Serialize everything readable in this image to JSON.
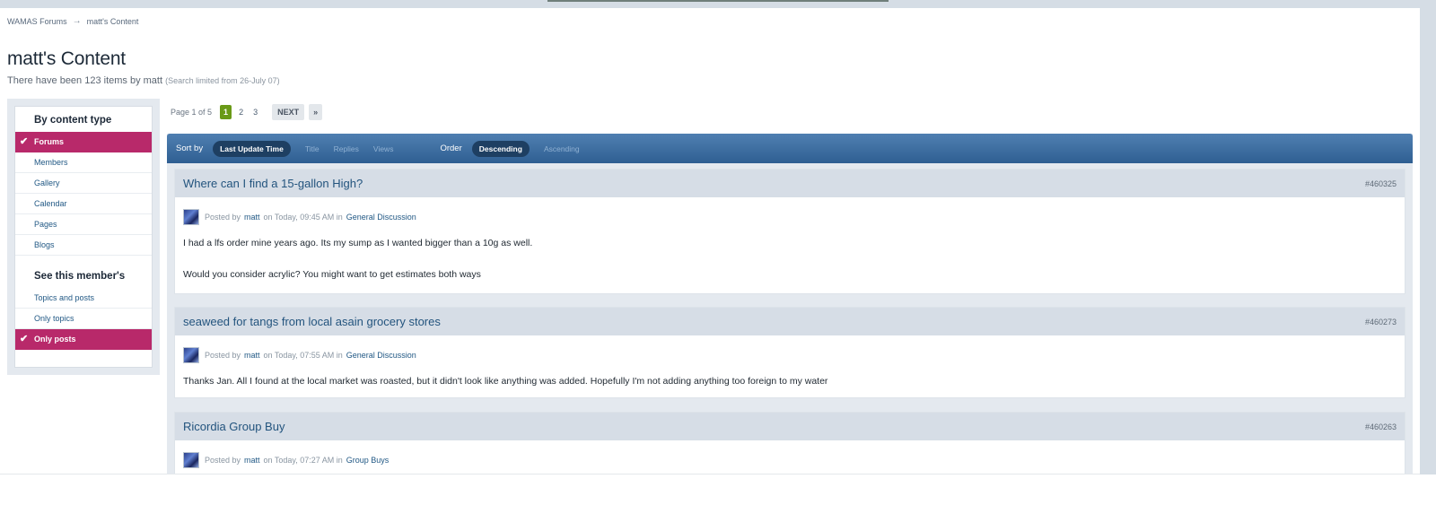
{
  "breadcrumb": {
    "root": "WAMAS Forums",
    "separator": "→",
    "current": "matt's Content"
  },
  "header": {
    "title": "matt's Content",
    "subtitle": "There have been 123 items by matt",
    "limit_note": "(Search limited from 26-July 07)"
  },
  "sidebar": {
    "heading1": "By content type",
    "content_types": [
      {
        "label": "Forums",
        "active": true
      },
      {
        "label": "Members",
        "active": false
      },
      {
        "label": "Gallery",
        "active": false
      },
      {
        "label": "Calendar",
        "active": false
      },
      {
        "label": "Pages",
        "active": false
      },
      {
        "label": "Blogs",
        "active": false
      }
    ],
    "heading2": "See this member's",
    "member_views": [
      {
        "label": "Topics and posts",
        "active": false
      },
      {
        "label": "Only topics",
        "active": false
      },
      {
        "label": "Only posts",
        "active": true
      }
    ],
    "check_glyph": "✔"
  },
  "pagination": {
    "label": "Page 1 of 5",
    "pages": [
      "1",
      "2",
      "3"
    ],
    "current": "1",
    "next": "NEXT",
    "last": "»"
  },
  "sortbar": {
    "sort_label": "Sort by",
    "sort_active": "Last Update Time",
    "sort_options": [
      "Title",
      "Replies",
      "Views"
    ],
    "order_label": "Order",
    "order_active": "Descending",
    "order_options": [
      "Ascending"
    ]
  },
  "posts": [
    {
      "title": "Where can I find a 15-gallon High?",
      "id": "#460325",
      "posted_by": "Posted by",
      "user": "matt",
      "on": "on Today, 09:45 AM in",
      "forum": "General Discussion",
      "body": [
        "I had a lfs order mine years ago. Its my sump as I wanted bigger than a 10g as well.",
        "Would you consider acrylic? You might want to get estimates both ways"
      ]
    },
    {
      "title": "seaweed for tangs from local asain grocery stores",
      "id": "#460273",
      "posted_by": "Posted by",
      "user": "matt",
      "on": "on Today, 07:55 AM in",
      "forum": "General Discussion",
      "body": [
        "Thanks Jan. All I found at the local market was roasted, but it didn't look like anything was added. Hopefully I'm not adding anything too foreign to my water"
      ]
    },
    {
      "title": "Ricordia Group Buy",
      "id": "#460263",
      "posted_by": "Posted by",
      "user": "matt",
      "on": "on Today, 07:27 AM in",
      "forum": "Group Buys",
      "body": []
    }
  ],
  "colors": {
    "accent_active": "#b8296a",
    "sortbar": "#3a6a9c",
    "current_page": "#6a9a17",
    "link": "#225985"
  }
}
